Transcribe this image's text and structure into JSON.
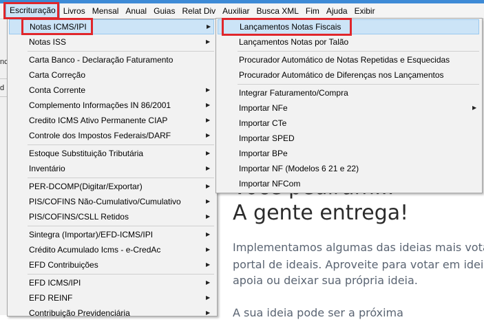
{
  "menubar": [
    "Escrituração",
    "Livros",
    "Mensal",
    "Anual",
    "Guias",
    "Relat Div",
    "Auxiliar",
    "Busca XML",
    "Fim",
    "Ajuda",
    "Exibir"
  ],
  "left_fragments": [
    "nc",
    "d"
  ],
  "submenu1": [
    {
      "label": "Notas ICMS/IPI",
      "arrow": true,
      "highlight": true
    },
    {
      "label": "Notas ISS",
      "arrow": true
    },
    {
      "sep": true
    },
    {
      "label": "Carta Banco - Declaração Faturamento"
    },
    {
      "label": "Carta Correção"
    },
    {
      "label": "Conta Corrente",
      "arrow": true
    },
    {
      "label": "Complemento Informações IN 86/2001",
      "arrow": true
    },
    {
      "label": "Credito ICMS Ativo Permanente CIAP",
      "arrow": true
    },
    {
      "label": "Controle dos Impostos Federais/DARF",
      "arrow": true
    },
    {
      "sep": true
    },
    {
      "label": "Estoque Substituição Tributária",
      "arrow": true
    },
    {
      "label": "Inventário",
      "arrow": true
    },
    {
      "sep": true
    },
    {
      "label": "PER-DCOMP(Digitar/Exportar)",
      "arrow": true
    },
    {
      "label": "PIS/COFINS Não-Cumulativo/Cumulativo",
      "arrow": true
    },
    {
      "label": "PIS/COFINS/CSLL Retidos",
      "arrow": true
    },
    {
      "sep": true
    },
    {
      "label": "Sintegra (Importar)/EFD-ICMS/IPI",
      "arrow": true
    },
    {
      "label": "Crédito Acumulado Icms - e-CredAc",
      "arrow": true
    },
    {
      "label": "EFD Contribuições",
      "arrow": true
    },
    {
      "sep": true
    },
    {
      "label": "EFD ICMS/IPI",
      "arrow": true
    },
    {
      "label": "EFD REINF",
      "arrow": true
    },
    {
      "label": "Contribuição Previdenciária",
      "arrow": true
    }
  ],
  "submenu2": [
    {
      "label": "Lançamentos Notas Fiscais",
      "highlight": true
    },
    {
      "label": "Lançamentos Notas por Talão"
    },
    {
      "sep": true
    },
    {
      "label": "Procurador Automático de Notas Repetidas e Esquecidas"
    },
    {
      "label": "Procurador Automático de Diferenças nos Lançamentos"
    },
    {
      "sep": true
    },
    {
      "label": "Integrar Faturamento/Compra"
    },
    {
      "label": "Importar NFe",
      "arrow": true
    },
    {
      "label": "Importar CTe"
    },
    {
      "label": "Importar SPED"
    },
    {
      "label": "Importar BPe"
    },
    {
      "label": "Importar NF (Modelos 6 21 e 22)"
    },
    {
      "label": "Importar NFCom"
    }
  ],
  "promo": {
    "partial_heading": "Você pediram...",
    "heading": "A gente entrega!",
    "lines": [
      "Implementamos algumas das ideias mais votada",
      "portal de ideais. Aproveite para votar em ideias q",
      "apoia ou deixar sua própria ideia.",
      "",
      "A sua ideia pode ser a próxima"
    ]
  },
  "colors": {
    "highlight": "#cce4f7",
    "annotation_red": "#e0262b",
    "menu_bg": "#f2f2f2",
    "topstrip": "#3d8ad6"
  }
}
